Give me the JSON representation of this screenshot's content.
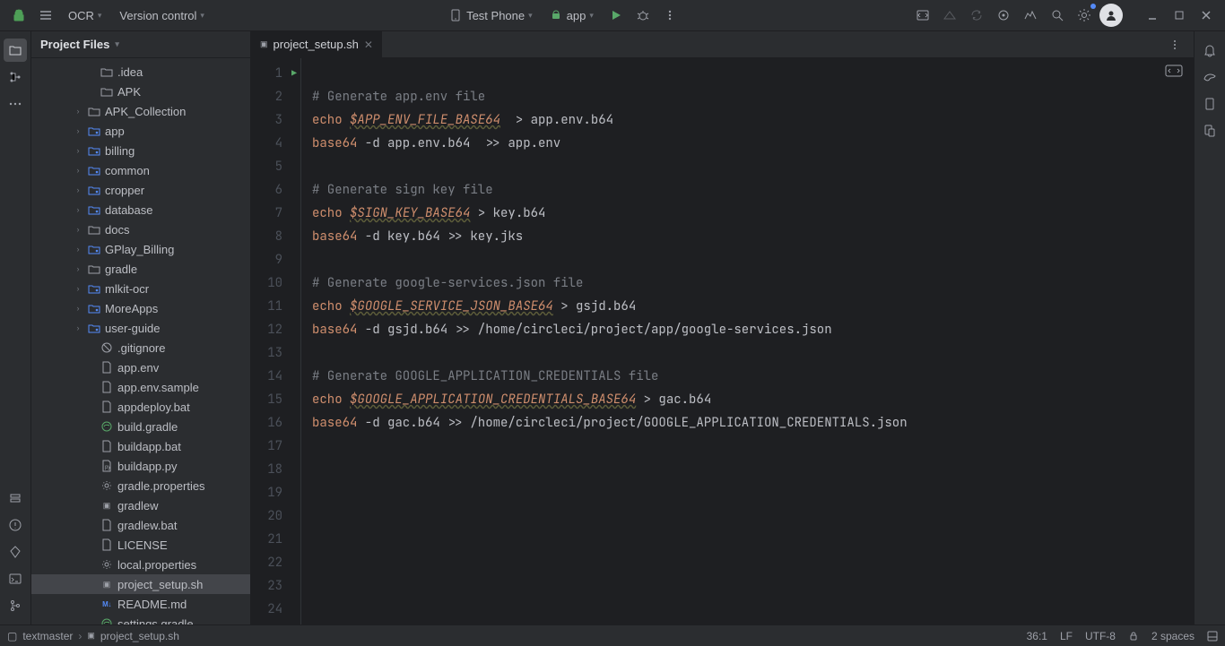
{
  "menubar": {
    "project_dropdown": "OCR",
    "vcs_dropdown": "Version control",
    "device": "Test Phone",
    "run_config": "app"
  },
  "project_panel": {
    "title": "Project Files"
  },
  "tree": [
    {
      "ind": 3,
      "arrow": "",
      "icon": "folder",
      "label": ".idea"
    },
    {
      "ind": 3,
      "arrow": "",
      "icon": "folder",
      "label": "APK"
    },
    {
      "ind": 2,
      "arrow": ">",
      "icon": "folder",
      "label": "APK_Collection"
    },
    {
      "ind": 2,
      "arrow": ">",
      "icon": "module",
      "label": "app"
    },
    {
      "ind": 2,
      "arrow": ">",
      "icon": "module",
      "label": "billing"
    },
    {
      "ind": 2,
      "arrow": ">",
      "icon": "module",
      "label": "common"
    },
    {
      "ind": 2,
      "arrow": ">",
      "icon": "module",
      "label": "cropper"
    },
    {
      "ind": 2,
      "arrow": ">",
      "icon": "module",
      "label": "database"
    },
    {
      "ind": 2,
      "arrow": ">",
      "icon": "folder",
      "label": "docs"
    },
    {
      "ind": 2,
      "arrow": ">",
      "icon": "module",
      "label": "GPlay_Billing"
    },
    {
      "ind": 2,
      "arrow": ">",
      "icon": "folder",
      "label": "gradle"
    },
    {
      "ind": 2,
      "arrow": ">",
      "icon": "module",
      "label": "mlkit-ocr"
    },
    {
      "ind": 2,
      "arrow": ">",
      "icon": "module",
      "label": "MoreApps"
    },
    {
      "ind": 2,
      "arrow": ">",
      "icon": "module",
      "label": "user-guide"
    },
    {
      "ind": 3,
      "arrow": "",
      "icon": "gitignore",
      "label": ".gitignore"
    },
    {
      "ind": 3,
      "arrow": "",
      "icon": "file",
      "label": "app.env"
    },
    {
      "ind": 3,
      "arrow": "",
      "icon": "file",
      "label": "app.env.sample"
    },
    {
      "ind": 3,
      "arrow": "",
      "icon": "file",
      "label": "appdeploy.bat"
    },
    {
      "ind": 3,
      "arrow": "",
      "icon": "gradle",
      "label": "build.gradle"
    },
    {
      "ind": 3,
      "arrow": "",
      "icon": "file",
      "label": "buildapp.bat"
    },
    {
      "ind": 3,
      "arrow": "",
      "icon": "python",
      "label": "buildapp.py"
    },
    {
      "ind": 3,
      "arrow": "",
      "icon": "gear",
      "label": "gradle.properties"
    },
    {
      "ind": 3,
      "arrow": "",
      "icon": "sh",
      "label": "gradlew"
    },
    {
      "ind": 3,
      "arrow": "",
      "icon": "file",
      "label": "gradlew.bat"
    },
    {
      "ind": 3,
      "arrow": "",
      "icon": "file",
      "label": "LICENSE"
    },
    {
      "ind": 3,
      "arrow": "",
      "icon": "gear",
      "label": "local.properties"
    },
    {
      "ind": 3,
      "arrow": "",
      "icon": "sh",
      "label": "project_setup.sh",
      "selected": true
    },
    {
      "ind": 3,
      "arrow": "",
      "icon": "md",
      "label": "README.md"
    },
    {
      "ind": 3,
      "arrow": "",
      "icon": "gradle",
      "label": "settings.gradle"
    }
  ],
  "tab": {
    "filename": "project_setup.sh"
  },
  "code": {
    "lines": [
      {
        "n": 1,
        "run": true,
        "tokens": []
      },
      {
        "n": 2,
        "tokens": [
          {
            "c": "comment",
            "t": "# Generate app.env file"
          }
        ]
      },
      {
        "n": 3,
        "tokens": [
          {
            "c": "keyword",
            "t": "echo"
          },
          {
            "c": "plain",
            "t": " "
          },
          {
            "c": "varu",
            "t": "$APP_ENV_FILE_BASE64"
          },
          {
            "c": "plain",
            "t": "  > app.env.b64"
          }
        ]
      },
      {
        "n": 4,
        "tokens": [
          {
            "c": "keyword",
            "t": "base64"
          },
          {
            "c": "plain",
            "t": " -d app.env.b64  >> app.env"
          }
        ]
      },
      {
        "n": 5,
        "tokens": []
      },
      {
        "n": 6,
        "tokens": [
          {
            "c": "comment",
            "t": "# Generate sign key file"
          }
        ]
      },
      {
        "n": 7,
        "tokens": [
          {
            "c": "keyword",
            "t": "echo"
          },
          {
            "c": "plain",
            "t": " "
          },
          {
            "c": "varu",
            "t": "$SIGN_KEY_BASE64"
          },
          {
            "c": "plain",
            "t": " > key.b64"
          }
        ]
      },
      {
        "n": 8,
        "tokens": [
          {
            "c": "keyword",
            "t": "base64"
          },
          {
            "c": "plain",
            "t": " -d key.b64 >> key.jks"
          }
        ]
      },
      {
        "n": 9,
        "tokens": []
      },
      {
        "n": 10,
        "tokens": [
          {
            "c": "comment",
            "t": "# Generate google-services.json file"
          }
        ]
      },
      {
        "n": 11,
        "tokens": [
          {
            "c": "keyword",
            "t": "echo"
          },
          {
            "c": "plain",
            "t": " "
          },
          {
            "c": "varu",
            "t": "$GOOGLE_SERVICE_JSON_BASE64"
          },
          {
            "c": "plain",
            "t": " > gsjd.b64"
          }
        ]
      },
      {
        "n": 12,
        "tokens": [
          {
            "c": "keyword",
            "t": "base64"
          },
          {
            "c": "plain",
            "t": " -d gsjd.b64 >> /home/circleci/project/app/google-services.json"
          }
        ]
      },
      {
        "n": 13,
        "tokens": []
      },
      {
        "n": 14,
        "tokens": [
          {
            "c": "comment",
            "t": "# Generate GOOGLE_APPLICATION_CREDENTIALS file"
          }
        ]
      },
      {
        "n": 15,
        "tokens": [
          {
            "c": "keyword",
            "t": "echo"
          },
          {
            "c": "plain",
            "t": " "
          },
          {
            "c": "varu",
            "t": "$GOOGLE_APPLICATION_CREDENTIALS_BASE64"
          },
          {
            "c": "plain",
            "t": " > gac.b64"
          }
        ]
      },
      {
        "n": 16,
        "tokens": [
          {
            "c": "keyword",
            "t": "base64"
          },
          {
            "c": "plain",
            "t": " -d gac.b64 >> /home/circleci/project/GOOGLE_APPLICATION_CREDENTIALS.json"
          }
        ]
      },
      {
        "n": 17,
        "tokens": []
      },
      {
        "n": 18,
        "tokens": []
      },
      {
        "n": 19,
        "tokens": []
      },
      {
        "n": 20,
        "tokens": []
      },
      {
        "n": 21,
        "tokens": []
      },
      {
        "n": 22,
        "tokens": []
      },
      {
        "n": 23,
        "tokens": []
      },
      {
        "n": 24,
        "tokens": []
      }
    ]
  },
  "status": {
    "bc_root": "textmaster",
    "bc_file": "project_setup.sh",
    "cursor": "36:1",
    "line_sep": "LF",
    "encoding": "UTF-8",
    "indent": "2 spaces"
  }
}
